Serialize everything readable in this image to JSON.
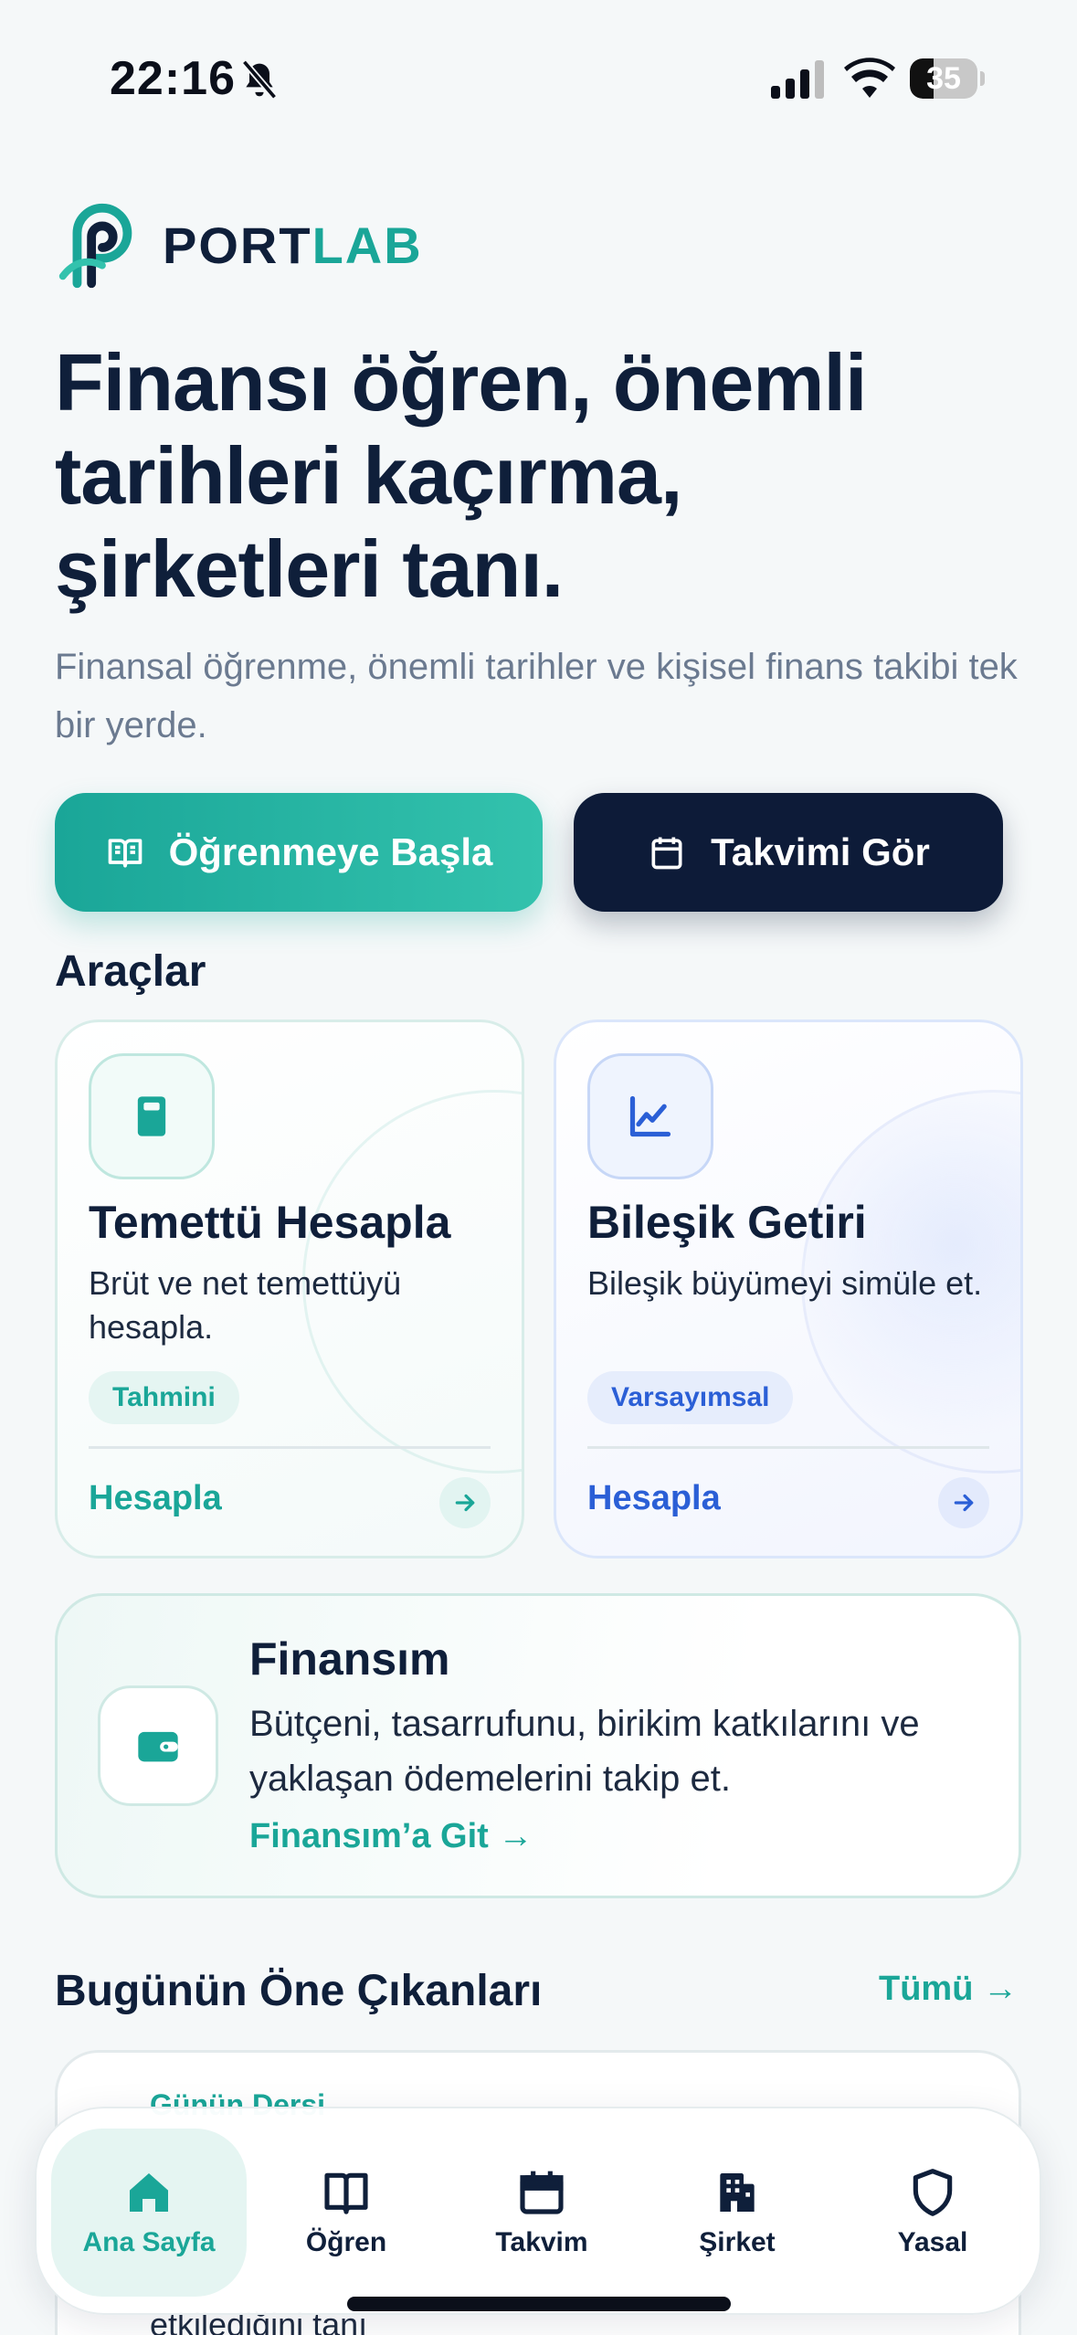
{
  "status_bar": {
    "time": "22:16",
    "battery": "35",
    "battery_level": 0.35
  },
  "brand": {
    "part1": "PORT",
    "part2": "LAB"
  },
  "hero": {
    "title": "Finansı öğren, önemli tarihleri kaçırma, şirketleri tanı.",
    "subtitle": "Finansal öğrenme, önemli tarihler ve kişisel finans takibi tek bir yerde."
  },
  "actions": {
    "learn": "Öğrenmeye Başla",
    "calendar": "Takvimi Gör"
  },
  "tools": {
    "title": "Araçlar",
    "cards": [
      {
        "title": "Temettü Hesapla",
        "desc": "Brüt ve net temettüyü hesapla.",
        "badge": "Tahmini",
        "action": "Hesapla",
        "icon": "calculator-icon"
      },
      {
        "title": "Bileşik Getiri",
        "desc": "Bileşik büyümeyi simüle et.",
        "badge": "Varsayımsal",
        "action": "Hesapla",
        "icon": "line-chart-icon"
      }
    ]
  },
  "finansim": {
    "title": "Finansım",
    "desc": "Bütçeni, tasarrufunu, birikim katkılarını ve yaklaşan ödemelerini takip et.",
    "link": "Finansım’a Git →"
  },
  "highlights": {
    "title": "Bugünün Öne Çıkanları",
    "all": "Tümü",
    "card_label": "Günün Dersi",
    "card_text": "etkilediğini tanı"
  },
  "tabs": [
    {
      "label": "Ana Sayfa",
      "icon": "home-icon",
      "active": true
    },
    {
      "label": "Öğren",
      "icon": "book-icon",
      "active": false
    },
    {
      "label": "Takvim",
      "icon": "calendar-icon",
      "active": false
    },
    {
      "label": "Şirket",
      "icon": "building-icon",
      "active": false
    },
    {
      "label": "Yasal",
      "icon": "shield-icon",
      "active": false
    }
  ],
  "colors": {
    "accent": "#1aa698",
    "navy": "#0d1b38",
    "blue": "#2b5fd6"
  }
}
